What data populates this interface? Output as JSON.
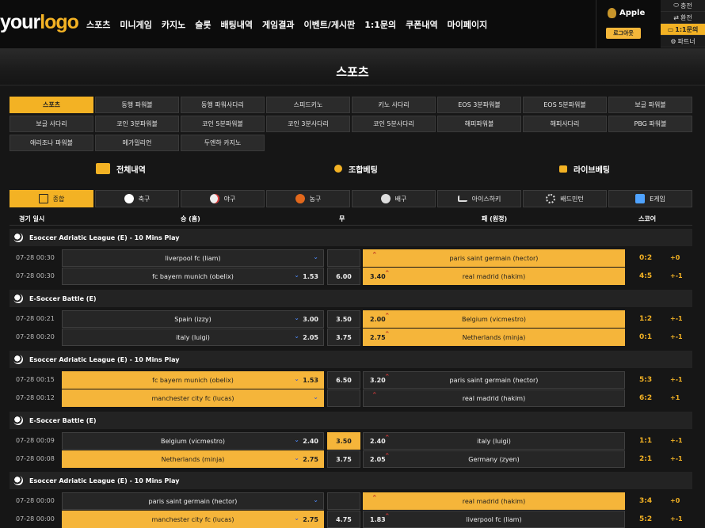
{
  "brand": {
    "logo_main": "your",
    "logo_accent": "logo"
  },
  "nav": [
    "스포츠",
    "미니게임",
    "카지노",
    "슬롯",
    "배팅내역",
    "게임결과",
    "이벤트/게시판",
    "1:1문의",
    "쿠폰내역",
    "마이페이지"
  ],
  "user": {
    "name": "Apple",
    "logout": "로그아웃"
  },
  "side_links": [
    {
      "label": "충전",
      "icon": "coin-icon",
      "active": false
    },
    {
      "label": "환전",
      "icon": "exchange-icon",
      "active": false
    },
    {
      "label": "1:1문의",
      "icon": "chat-icon",
      "active": true
    },
    {
      "label": "파트너",
      "icon": "partner-icon",
      "active": false
    }
  ],
  "page_title": "스포츠",
  "game_types": [
    {
      "label": "스포츠",
      "active": true
    },
    {
      "label": "동행 파워볼"
    },
    {
      "label": "동행 파워사다리"
    },
    {
      "label": "스피드키노"
    },
    {
      "label": "키노 사다리"
    },
    {
      "label": "EOS 3분파워볼"
    },
    {
      "label": "EOS 5분파워볼"
    },
    {
      "label": "보글 파워볼"
    },
    {
      "label": "보글 사다리"
    },
    {
      "label": "코인 3분파워볼"
    },
    {
      "label": "코인 5분파워볼"
    },
    {
      "label": "코인 3분사다리"
    },
    {
      "label": "코인 5분사다리"
    },
    {
      "label": "해피파워볼"
    },
    {
      "label": "해피사다리"
    },
    {
      "label": "PBG 파워볼"
    },
    {
      "label": "애리조나 파워볼"
    },
    {
      "label": "메가밀리언"
    },
    {
      "label": "두엔하 카지노"
    }
  ],
  "bet_tabs": [
    {
      "label": "전체내역",
      "icon": "list-icon"
    },
    {
      "label": "조합베팅",
      "icon": "combo-icon"
    },
    {
      "label": "라이브베팅",
      "icon": "tv-icon"
    }
  ],
  "sport_tabs": [
    {
      "label": "종합",
      "icon": "grid-icon",
      "active": true
    },
    {
      "label": "축구",
      "icon": "soccer-icon"
    },
    {
      "label": "야구",
      "icon": "baseball-icon"
    },
    {
      "label": "농구",
      "icon": "basketball-icon"
    },
    {
      "label": "배구",
      "icon": "volleyball-icon"
    },
    {
      "label": "아이스하키",
      "icon": "hockey-icon"
    },
    {
      "label": "배드민턴",
      "icon": "badminton-icon"
    },
    {
      "label": "E게임",
      "icon": "egame-icon"
    }
  ],
  "columns": {
    "time": "경기 일시",
    "home": "승 (홈)",
    "draw": "무",
    "away": "패 (원정)",
    "score": "스코어"
  },
  "groups": [
    {
      "league": "Esoccer Adriatic League (E) - 10 Mins Play",
      "matches": [
        {
          "time": "07-28 00:30",
          "home": "liverpool fc (liam)",
          "home_odd": "",
          "draw": "",
          "away": "paris saint germain (hector)",
          "away_odd": "",
          "score": "0:2",
          "diff": "+0",
          "sel": "away"
        },
        {
          "time": "07-28 00:30",
          "home": "fc bayern munich (obelix)",
          "home_odd": "1.53",
          "draw": "6.00",
          "away": "real madrid (hakim)",
          "away_odd": "3.40",
          "score": "4:5",
          "diff": "+-1",
          "sel": "away"
        }
      ]
    },
    {
      "league": "E-Soccer Battle (E)",
      "matches": [
        {
          "time": "07-28 00:21",
          "home": "Spain (izzy)",
          "home_odd": "3.00",
          "draw": "3.50",
          "away": "Belgium (vicmestro)",
          "away_odd": "2.00",
          "score": "1:2",
          "diff": "+-1",
          "sel": "away"
        },
        {
          "time": "07-28 00:20",
          "home": "italy (luigi)",
          "home_odd": "2.05",
          "draw": "3.75",
          "away": "Netherlands (minja)",
          "away_odd": "2.75",
          "score": "0:1",
          "diff": "+-1",
          "sel": "away"
        }
      ]
    },
    {
      "league": "Esoccer Adriatic League (E) - 10 Mins Play",
      "matches": [
        {
          "time": "07-28 00:15",
          "home": "fc bayern munich (obelix)",
          "home_odd": "1.53",
          "draw": "6.50",
          "away": "paris saint germain (hector)",
          "away_odd": "3.20",
          "score": "5:3",
          "diff": "+-1",
          "sel": "home"
        },
        {
          "time": "07-28 00:12",
          "home": "manchester city fc (lucas)",
          "home_odd": "",
          "draw": "",
          "away": "real madrid (hakim)",
          "away_odd": "",
          "score": "6:2",
          "diff": "+1",
          "sel": "home"
        }
      ]
    },
    {
      "league": "E-Soccer Battle (E)",
      "matches": [
        {
          "time": "07-28 00:09",
          "home": "Belgium (vicmestro)",
          "home_odd": "2.40",
          "draw": "3.50",
          "away": "italy (luigi)",
          "away_odd": "2.40",
          "score": "1:1",
          "diff": "+-1",
          "sel": "draw"
        },
        {
          "time": "07-28 00:08",
          "home": "Netherlands (minja)",
          "home_odd": "2.75",
          "draw": "3.75",
          "away": "Germany (zyen)",
          "away_odd": "2.05",
          "score": "2:1",
          "diff": "+-1",
          "sel": "home"
        }
      ]
    },
    {
      "league": "Esoccer Adriatic League (E) - 10 Mins Play",
      "matches": [
        {
          "time": "07-28 00:00",
          "home": "paris saint germain (hector)",
          "home_odd": "",
          "draw": "",
          "away": "real madrid (hakim)",
          "away_odd": "",
          "score": "3:4",
          "diff": "+0",
          "sel": "away"
        },
        {
          "time": "07-28 00:00",
          "home": "manchester city fc (lucas)",
          "home_odd": "2.75",
          "draw": "4.75",
          "away": "liverpool fc (liam)",
          "away_odd": "1.83",
          "score": "5:2",
          "diff": "+-1",
          "sel": "home"
        }
      ]
    }
  ]
}
